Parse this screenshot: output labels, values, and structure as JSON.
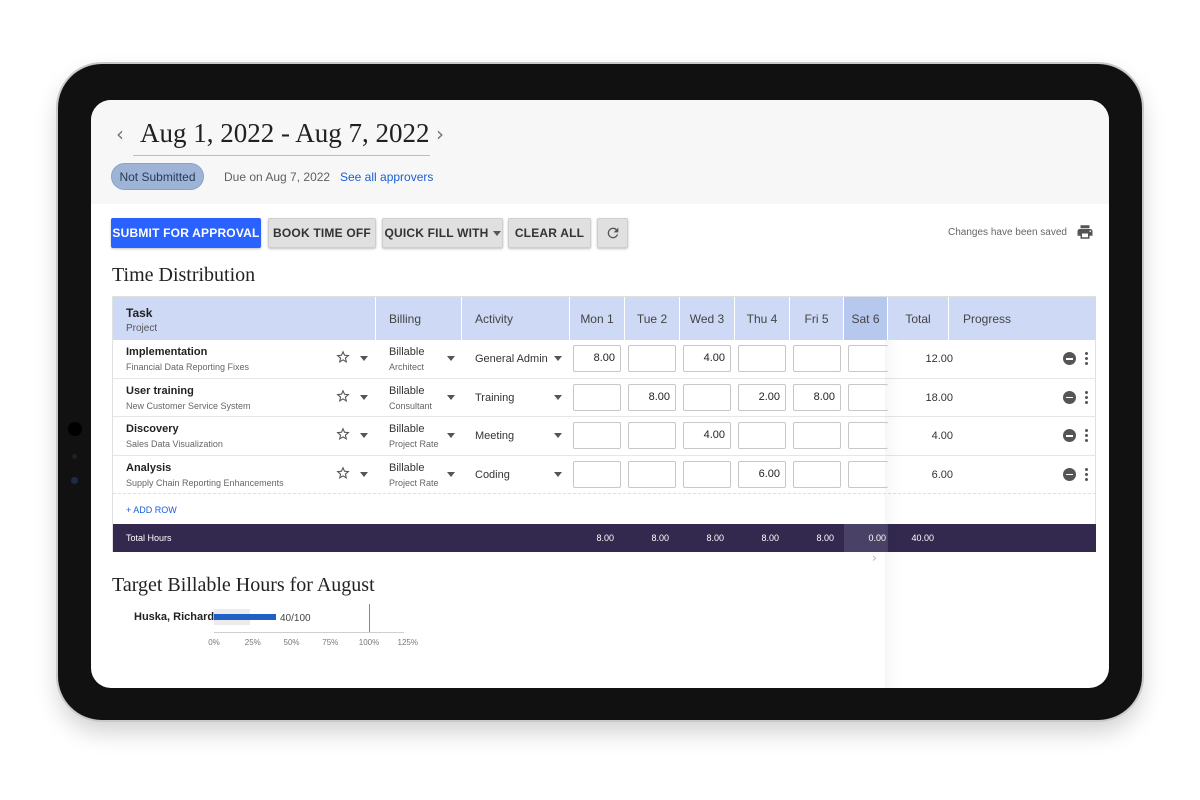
{
  "header": {
    "date_range": "Aug 1, 2022 - Aug 7, 2022",
    "status": "Not Submitted",
    "due": "Due on Aug 7, 2022",
    "approvers_link": "See all approvers"
  },
  "toolbar": {
    "submit": "SUBMIT FOR APPROVAL",
    "book_time_off": "BOOK TIME OFF",
    "quick_fill": "QUICK FILL WITH",
    "clear_all": "CLEAR ALL",
    "saved_msg": "Changes have been saved"
  },
  "time_distribution": {
    "title": "Time Distribution",
    "columns": {
      "task": "Task",
      "project": "Project",
      "billing": "Billing",
      "activity": "Activity",
      "days": [
        "Mon 1",
        "Tue 2",
        "Wed 3",
        "Thu 4",
        "Fri 5",
        "Sat 6"
      ],
      "total": "Total",
      "progress": "Progress"
    },
    "rows": [
      {
        "task": "Implementation",
        "project": "Financial Data Reporting Fixes",
        "billing": "Billable",
        "rate": "Architect",
        "activity": "General Admin",
        "hours": [
          "8.00",
          "",
          "4.00",
          "",
          "",
          ""
        ],
        "total": "12.00"
      },
      {
        "task": "User training",
        "project": "New Customer Service System",
        "billing": "Billable",
        "rate": "Consultant",
        "activity": "Training",
        "hours": [
          "",
          "8.00",
          "",
          "2.00",
          "8.00",
          ""
        ],
        "total": "18.00"
      },
      {
        "task": "Discovery",
        "project": "Sales Data Visualization",
        "billing": "Billable",
        "rate": "Project Rate",
        "activity": "Meeting",
        "hours": [
          "",
          "",
          "4.00",
          "",
          "",
          ""
        ],
        "total": "4.00"
      },
      {
        "task": "Analysis",
        "project": "Supply Chain Reporting Enhancements",
        "billing": "Billable",
        "rate": "Project Rate",
        "activity": "Coding",
        "hours": [
          "",
          "",
          "",
          "6.00",
          "",
          ""
        ],
        "total": "6.00"
      }
    ],
    "add_row": "+ ADD ROW",
    "totals": {
      "label": "Total Hours",
      "days": [
        "8.00",
        "8.00",
        "8.00",
        "8.00",
        "8.00",
        "0.00"
      ],
      "grand": "40.00"
    }
  },
  "target": {
    "title": "Target Billable Hours for August",
    "person": "Huska, Richard",
    "label": "40/100",
    "value": 40,
    "target": 100,
    "ticks": [
      "0%",
      "25%",
      "50%",
      "75%",
      "100%",
      "125%"
    ]
  },
  "icons": {
    "prev": "chevron-left-icon",
    "next": "chevron-right-icon",
    "refresh": "refresh-icon",
    "print": "print-icon",
    "star": "star-outline-icon",
    "remove": "minus-circle-icon",
    "more": "more-vertical-icon"
  },
  "colors": {
    "primary": "#2962ff",
    "header_bg": "#cdd9f5",
    "total_bar": "#33294f",
    "status_pill": "#9db4d6",
    "progress_bar": "#1f5fc6"
  }
}
